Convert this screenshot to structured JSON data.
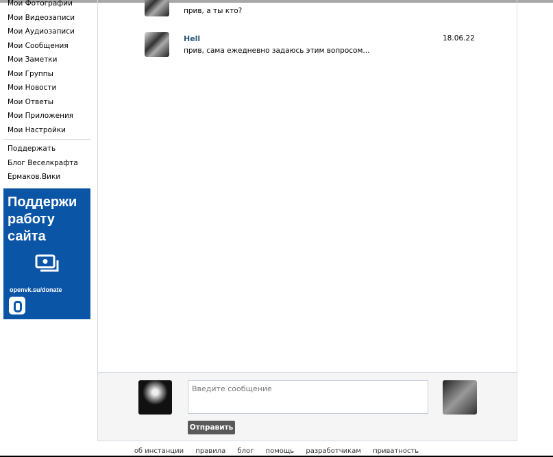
{
  "sidebar": {
    "items": [
      "Мои Фотографии",
      "Мои Видеозаписи",
      "Мои Аудиозаписи",
      "Мои Сообщения",
      "Мои Заметки",
      "Мои Группы",
      "Мои Новости",
      "Мои Ответы",
      "Мои Приложения",
      "Мои Настройки"
    ],
    "extra": [
      "Поддержать",
      "Блог Веселкрафта",
      "Ермаков.Вики"
    ]
  },
  "ad": {
    "line1": "Поддержи",
    "line2": "работу",
    "line3": "сайта",
    "url": "openvk.su/donate"
  },
  "messages": [
    {
      "text": "прив, а ты кто?"
    },
    {
      "name": "Hell",
      "text": "прив, сама ежедневно задаюсь этим вопросом...",
      "date": "18.06.22"
    }
  ],
  "compose": {
    "placeholder": "Введите сообщение",
    "send": "Отправить"
  },
  "footer": [
    "об инстанции",
    "правила",
    "блог",
    "помощь",
    "разработчикам",
    "приватность"
  ]
}
